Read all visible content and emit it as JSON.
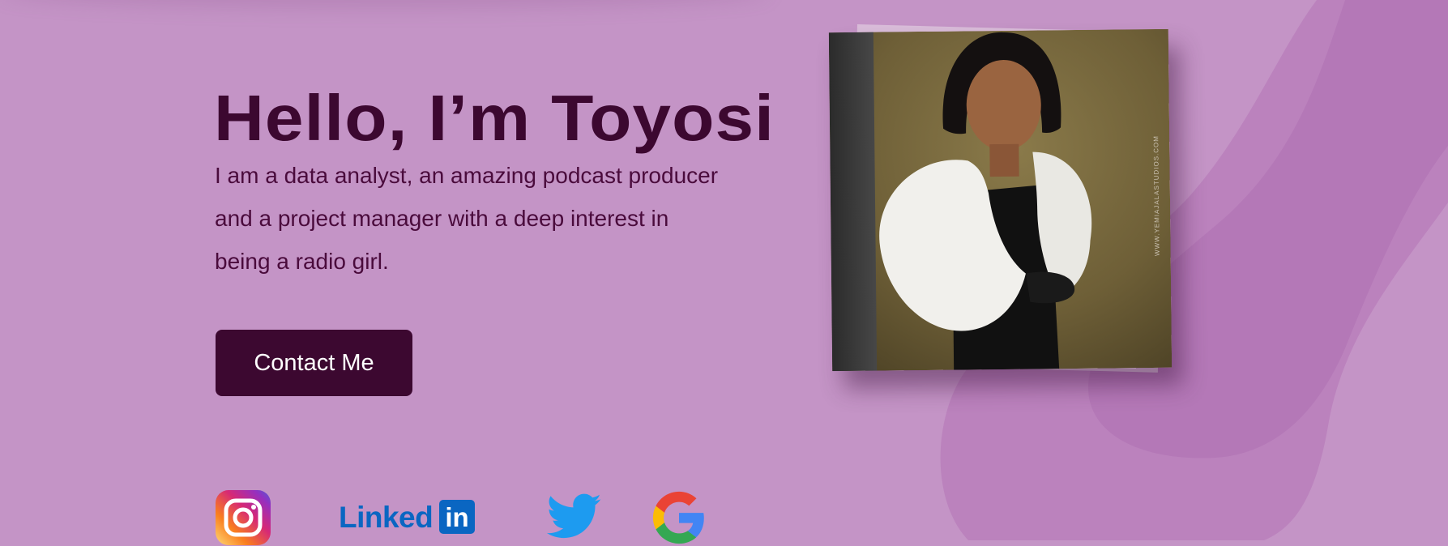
{
  "hero": {
    "title": "Hello, I’m Toyosi",
    "description": "I am a data analyst, an amazing podcast producer and a project manager with a deep interest in being a radio girl.",
    "contact_button_label": "Contact Me"
  },
  "photo": {
    "alt": "Portrait of Toyosi in a white puff-sleeve top",
    "watermark": "WWW.YEMIAJALASTUDIOS.COM"
  },
  "social": {
    "linkedin_word": "Linked",
    "linkedin_box": "in",
    "icons": [
      "instagram-icon",
      "linkedin-icon",
      "twitter-icon",
      "google-icon"
    ]
  },
  "colors": {
    "background": "#c494c6",
    "blob": "#b87ab9",
    "accent_dark": "#3c0830",
    "button_text": "#ffffff"
  }
}
